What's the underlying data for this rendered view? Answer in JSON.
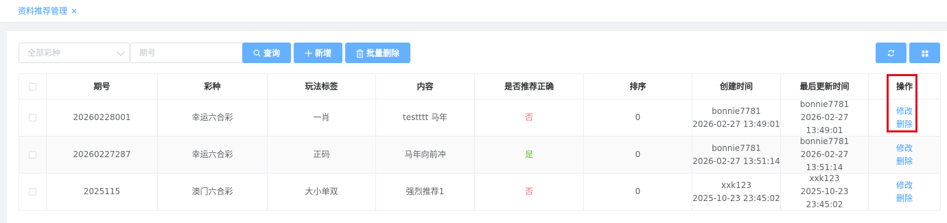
{
  "tabs": [
    {
      "label": "资料推荐管理",
      "close": "×"
    }
  ],
  "filters": {
    "lottery_type_placeholder": "全部彩种",
    "issue_placeholder": "期号",
    "issue_value": ""
  },
  "buttons": {
    "query": "查询",
    "add": "新增",
    "batch_delete": "批量删除"
  },
  "icons": {
    "query": "search-icon",
    "add": "plus-icon",
    "batch_delete": "trash-icon",
    "refresh": "refresh-icon",
    "grid": "grid-icon",
    "select": "chevron-down-icon"
  },
  "table": {
    "columns": [
      "期号",
      "彩种",
      "玩法标签",
      "内容",
      "是否推荐正确",
      "排序",
      "创建时间",
      "最后更新时间",
      "操作"
    ],
    "rows": [
      {
        "issue": "20260228001",
        "lottery": "幸运六合彩",
        "tag": "一肖",
        "content": "testttt 马年",
        "correct": "否",
        "sort": "0",
        "creator": "bonnie7781",
        "created": "2026-02-27 13:49:01",
        "updater": "bonnie7781",
        "updated": "2026-02-27 13:49:01",
        "edit": "修改",
        "delete": "删除"
      },
      {
        "issue": "20260227287",
        "lottery": "幸运六合彩",
        "tag": "正码",
        "content": "马年向前冲",
        "correct": "是",
        "sort": "0",
        "creator": "bonnie7781",
        "created": "2026-02-27 13:51:14",
        "updater": "bonnie7781",
        "updated": "2026-02-27 13:51:14",
        "edit": "修改",
        "delete": "删除"
      },
      {
        "issue": "2025115",
        "lottery": "澳门六合彩",
        "tag": "大小单双",
        "content": "强烈推荐1",
        "correct": "否",
        "sort": "0",
        "creator": "xxk123",
        "created": "2025-10-23 23:45:02",
        "updater": "xxk123",
        "updated": "2025-10-23 23:45:02",
        "edit": "修改",
        "delete": "删除"
      }
    ]
  },
  "colors": {
    "primary": "#409eff",
    "button": "#66b1ff",
    "no": "#f56c6c",
    "yes": "#67c23a",
    "highlight": "#e0101a"
  }
}
